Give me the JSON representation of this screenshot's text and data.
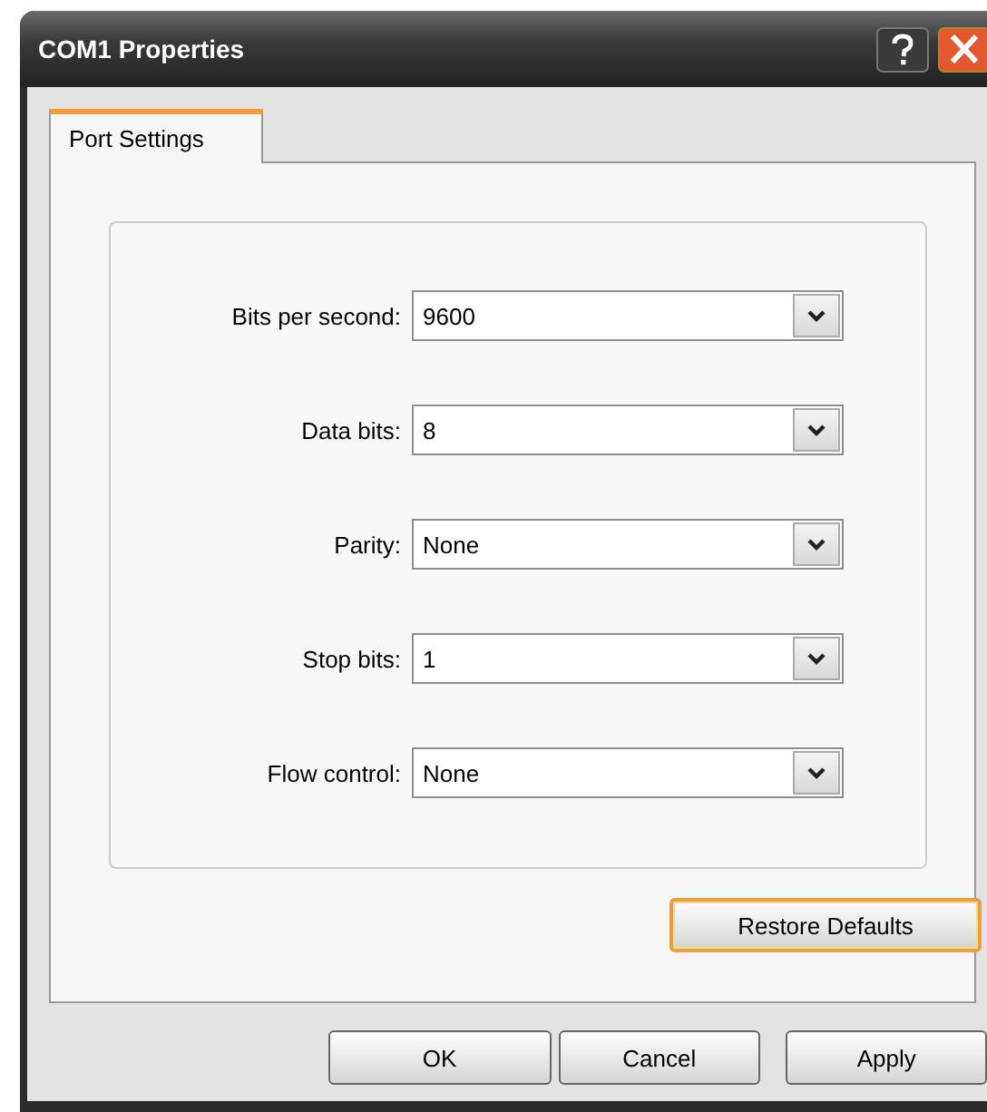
{
  "window": {
    "title": "COM1 Properties"
  },
  "tabs": [
    {
      "label": "Port Settings",
      "selected": true
    }
  ],
  "fields": [
    {
      "label": "Bits per second:",
      "value": "9600"
    },
    {
      "label": "Data bits:",
      "value": "8"
    },
    {
      "label": "Parity:",
      "value": "None"
    },
    {
      "label": "Stop bits:",
      "value": "1"
    },
    {
      "label": "Flow control:",
      "value": "None"
    }
  ],
  "restore_button": {
    "label": "Restore Defaults",
    "focused": true
  },
  "buttons": [
    "OK",
    "Cancel",
    "Apply"
  ]
}
